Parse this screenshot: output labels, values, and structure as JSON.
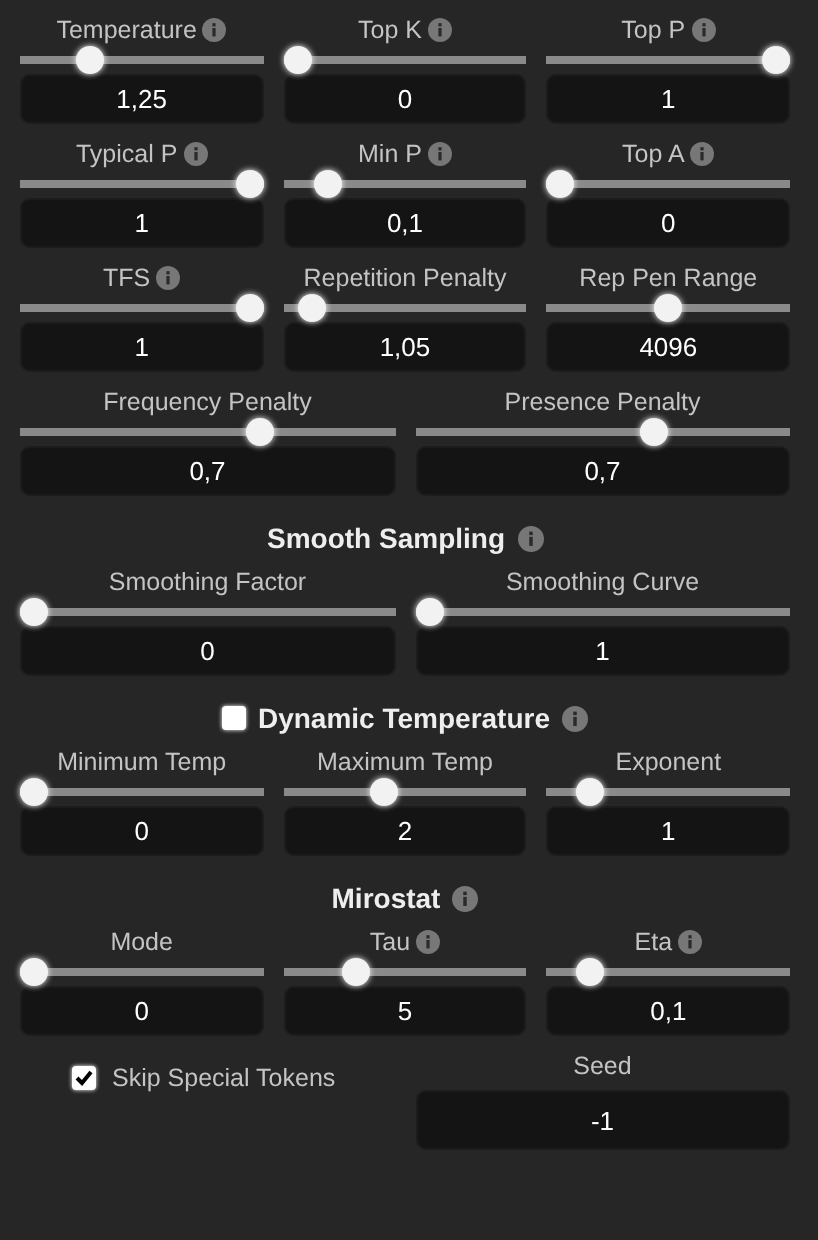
{
  "sections": [
    {
      "rows": [
        [
          {
            "kind": "slider",
            "label": "Temperature",
            "info": true,
            "value": "1,25",
            "level": 0.26
          },
          {
            "kind": "slider",
            "label": "Top K",
            "info": true,
            "value": "0",
            "level": 0
          },
          {
            "kind": "slider",
            "label": "Top P",
            "info": true,
            "value": "1",
            "level": 1
          }
        ],
        [
          {
            "kind": "slider",
            "label": "Typical P",
            "info": true,
            "value": "1",
            "level": 1
          },
          {
            "kind": "slider",
            "label": "Min P",
            "info": true,
            "value": "0,1",
            "level": 0.14
          },
          {
            "kind": "slider",
            "label": "Top A",
            "info": true,
            "value": "0",
            "level": 0
          }
        ],
        [
          {
            "kind": "slider",
            "label": "TFS",
            "info": true,
            "value": "1",
            "level": 1
          },
          {
            "kind": "slider",
            "label": "Repetition Penalty",
            "info": false,
            "value": "1,05",
            "level": 0.07
          },
          {
            "kind": "slider",
            "label": "Rep Pen Range",
            "info": false,
            "value": "4096",
            "level": 0.5
          }
        ]
      ]
    },
    {
      "rows": [
        [
          {
            "kind": "slider",
            "label": "Frequency Penalty",
            "info": false,
            "value": "0,7",
            "level": 0.65
          },
          {
            "kind": "slider",
            "label": "Presence Penalty",
            "info": false,
            "value": "0,7",
            "level": 0.65
          }
        ]
      ]
    },
    {
      "heading": {
        "text": "Smooth Sampling",
        "info": true
      },
      "rows": [
        [
          {
            "kind": "slider",
            "label": "Smoothing Factor",
            "info": false,
            "value": "0",
            "level": 0
          },
          {
            "kind": "slider",
            "label": "Smoothing Curve",
            "info": false,
            "value": "1",
            "level": 0
          }
        ]
      ]
    },
    {
      "heading": {
        "text": "Dynamic Temperature",
        "info": true,
        "checkbox": {
          "checked": false
        }
      },
      "rows": [
        [
          {
            "kind": "slider",
            "label": "Minimum Temp",
            "info": false,
            "value": "0",
            "level": 0
          },
          {
            "kind": "slider",
            "label": "Maximum Temp",
            "info": false,
            "value": "2",
            "level": 0.4
          },
          {
            "kind": "slider",
            "label": "Exponent",
            "info": false,
            "value": "1",
            "level": 0.14
          }
        ]
      ]
    },
    {
      "heading": {
        "text": "Mirostat",
        "info": true
      },
      "rows": [
        [
          {
            "kind": "slider",
            "label": "Mode",
            "info": false,
            "value": "0",
            "level": 0
          },
          {
            "kind": "slider",
            "label": "Tau",
            "info": true,
            "value": "5",
            "level": 0.27
          },
          {
            "kind": "slider",
            "label": "Eta",
            "info": true,
            "value": "0,1",
            "level": 0.14
          }
        ]
      ]
    },
    {
      "rows": [
        [
          {
            "kind": "checkbox",
            "label": "Skip Special Tokens",
            "checked": true
          },
          {
            "kind": "field",
            "label": "Seed",
            "value": "-1"
          }
        ]
      ]
    }
  ]
}
